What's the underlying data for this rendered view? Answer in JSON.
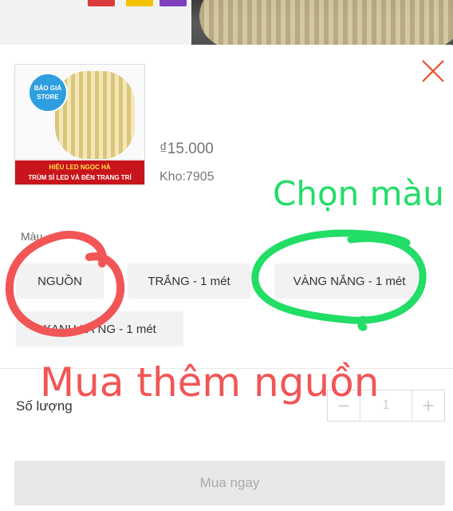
{
  "product": {
    "thumb_badge": "BÁO GIÁ STORE",
    "thumb_banner_line1": "HIỆU LED NGỌC HÀ",
    "thumb_banner_line2": "TRÙM SỈ LED VÀ ĐÈN TRANG TRÍ",
    "price": "₫15.000",
    "stock": "Kho:7905"
  },
  "variation": {
    "label": "Màu",
    "options": [
      {
        "label": "NGUỒN"
      },
      {
        "label": "TRẮNG - 1 mét"
      },
      {
        "label": "VÀNG NẮNG - 1 mét"
      },
      {
        "label": "XANH LÁ NG - 1 mét"
      }
    ]
  },
  "quantity": {
    "label": "Số lượng",
    "value": "1",
    "minus": "−",
    "plus": "+"
  },
  "buy_button": "Mua ngay",
  "annotations": {
    "chon_mau": "Chọn màu",
    "mua_them_nguon": "Mua thêm nguồn",
    "green": "#22dd66",
    "red": "#f25555"
  },
  "colors": {
    "accent": "#ee4d2d",
    "close": "#ee4d2d"
  }
}
